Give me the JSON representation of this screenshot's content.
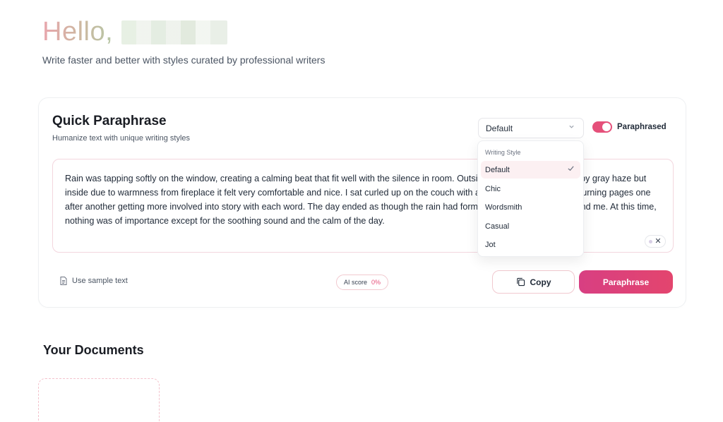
{
  "greeting": {
    "prefix": "Hello,"
  },
  "subtitle": "Write faster and better with styles curated by professional writers",
  "quick_paraphrase": {
    "title": "Quick Paraphrase",
    "subtitle": "Humanize text with unique writing styles",
    "style_select": {
      "value": "Default",
      "icon": "chevron-down-icon"
    },
    "toggle": {
      "label": "Paraphrased",
      "on": true,
      "color": "#e5507a"
    },
    "text": "Rain was tapping softly on the window, creating a calming beat that fit well with the silence in room. Outside seemed to be covered by gray haze but inside due to warmness from fireplace it felt very comfortable and nice. I sat curled up on the couch with an interesting book slowly turning pages one after another getting more involved into story with each word. The day ended as though the rain had formed a peaceful bubble around me. At this time, nothing was of importance except for the soothing sound and the calm of the day.",
    "clear_icon": "close-icon",
    "sample_link": "Use sample text",
    "ai_score": {
      "label": "AI score",
      "value": "0%"
    },
    "copy_button": "Copy",
    "paraphrase_button": "Paraphrase"
  },
  "dropdown": {
    "header": "Writing Style",
    "items": [
      {
        "label": "Default",
        "selected": true
      },
      {
        "label": "Chic",
        "selected": false
      },
      {
        "label": "Wordsmith",
        "selected": false
      },
      {
        "label": "Casual",
        "selected": false
      },
      {
        "label": "Jot",
        "selected": false
      }
    ],
    "check_icon": "check-icon"
  },
  "documents": {
    "title": "Your Documents"
  },
  "colors": {
    "accent": "#e5507a",
    "button_gradient_start": "#d83f82",
    "button_gradient_end": "#e3456e"
  }
}
